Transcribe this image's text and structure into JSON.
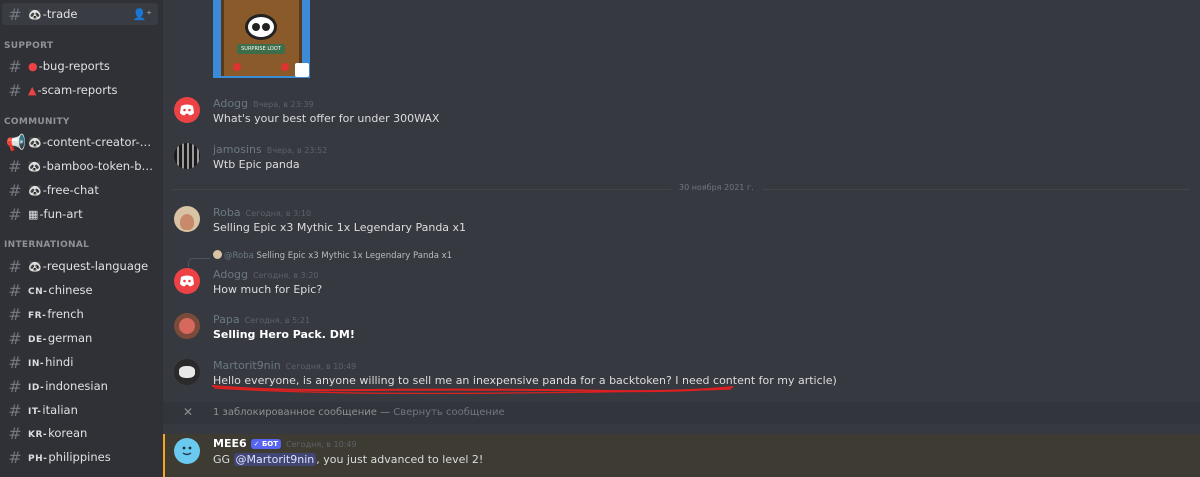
{
  "sidebar": {
    "channels": [
      {
        "name": "-trade",
        "icon": "panda-icon",
        "active": true
      },
      {
        "category": "SUPPORT"
      },
      {
        "name": "-bug-reports",
        "icon": "red-circle-icon"
      },
      {
        "name": "-scam-reports",
        "icon": "siren-icon"
      },
      {
        "category": "COMMUNITY"
      },
      {
        "name": "-content-creator-prog...",
        "icon": "panda-icon"
      },
      {
        "name": "-bamboo-token-bam",
        "icon": "panda-icon"
      },
      {
        "name": "-free-chat",
        "icon": "panda-icon"
      },
      {
        "name": "-fun-art",
        "icon": "frame-icon"
      },
      {
        "category": "INTERNATIONAL"
      },
      {
        "name": "-request-language",
        "icon": "panda-icon"
      },
      {
        "name": "chinese",
        "code": "CN-"
      },
      {
        "name": "french",
        "code": "FR-"
      },
      {
        "name": "german",
        "code": "DE-"
      },
      {
        "name": "hindi",
        "code": "IN-"
      },
      {
        "name": "indonesian",
        "code": "ID-"
      },
      {
        "name": "italian",
        "code": "IT-"
      },
      {
        "name": "korean",
        "code": "KR-"
      },
      {
        "name": "philippines",
        "code": "PH-"
      }
    ]
  },
  "messages": [
    {
      "author": "Adogg",
      "timestamp": "Вчера, в 23:39",
      "text": "What's your best offer for under 300WAX"
    },
    {
      "author": "jamosins",
      "timestamp": "Вчера, в 23:52",
      "text": "Wtb Epic panda"
    },
    {
      "divider": "30 ноября 2021 г."
    },
    {
      "author": "Roba",
      "timestamp": "Сегодня, в 3:10",
      "text": "Selling Epic x3 Mythic 1x Legendary Panda x1"
    },
    {
      "reply_to": "@Roba",
      "reply_text": "Selling Epic x3 Mythic 1x Legendary Panda x1",
      "author": "Adogg",
      "timestamp": "Сегодня, в 3:20",
      "text": "How much for Epic?"
    },
    {
      "author": "Papa",
      "timestamp": "Сегодня, в 5:21",
      "text": "Selling Hero Pack. DM!"
    },
    {
      "author": "Martorit9nin",
      "timestamp": "Сегодня, в 10:49",
      "text": "Hello everyone, is anyone willing to sell me an inexpensive panda for a backtoken? I need content for my article)"
    }
  ],
  "blocked": {
    "text": "1 заблокированное сообщение — ",
    "link": "Свернуть сообщение"
  },
  "mee6": {
    "author": "MEE6",
    "badge": "✓ БОТ",
    "timestamp": "Сегодня, в 10:49",
    "pre": "GG ",
    "mention": "@Martorit9nin",
    "post": ", you just advanced to level 2!"
  },
  "image_card": {
    "label": "SURPRISE LOOT"
  }
}
